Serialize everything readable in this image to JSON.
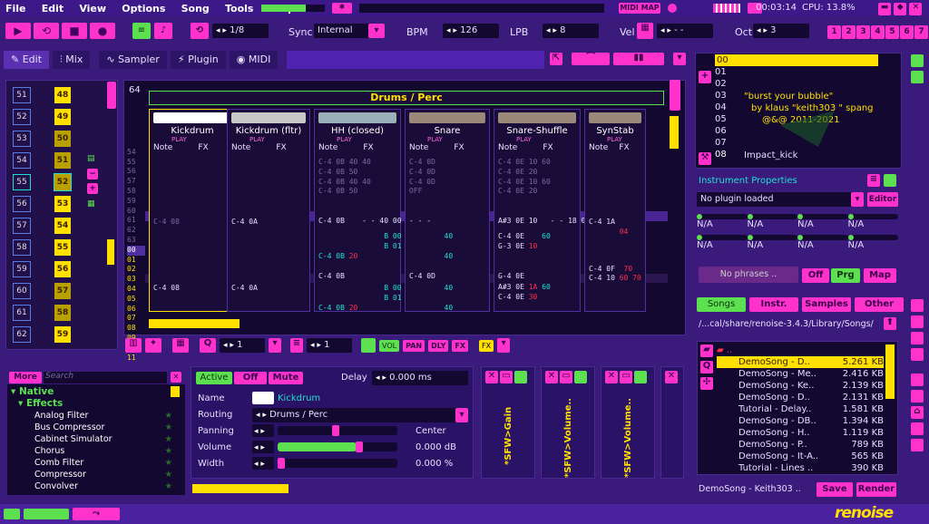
{
  "menu": [
    "File",
    "Edit",
    "View",
    "Options",
    "Song",
    "Tools",
    "Help"
  ],
  "top": {
    "midi_map": "MIDI MAP",
    "time": "00:03:14",
    "cpu": "CPU: 13.8%"
  },
  "transport": {
    "pattern_step": "1/8",
    "sync_label": "Sync",
    "sync_value": "Internal",
    "bpm_label": "BPM",
    "bpm": "126",
    "lpb_label": "LPB",
    "lpb": "8",
    "vel_label": "Vel",
    "vel": "- -",
    "oct_label": "Oct",
    "oct": "3",
    "octaves": [
      "1",
      "2",
      "3",
      "4",
      "5",
      "6",
      "7"
    ]
  },
  "tabs": {
    "edit": "Edit",
    "mix": "Mix",
    "sampler": "Sampler",
    "plugin": "Plugin",
    "midi": "MIDI"
  },
  "seq": {
    "left": [
      "51",
      "52",
      "53",
      "54",
      "55",
      "56",
      "57",
      "58",
      "59",
      "60",
      "61",
      "62"
    ],
    "right": [
      "48",
      "49",
      "50",
      "51",
      "52",
      "53",
      "54",
      "55",
      "56",
      "57",
      "58",
      "59"
    ],
    "pattern_lines": "64"
  },
  "pattern": {
    "group": "Drums / Perc",
    "tracks": [
      "Kickdrum",
      "Kickdrum (fltr)",
      "HH (closed)",
      "Snare",
      "Snare-Shuffle",
      "SynStab"
    ],
    "col_note": "Note",
    "col_fx": "FX",
    "play": "PLAY",
    "line_nums": [
      "54",
      "55",
      "56",
      "57",
      "58",
      "59",
      "60",
      "61",
      "62",
      "63",
      "00",
      "01",
      "02",
      "03",
      "04",
      "05",
      "06",
      "07",
      "08",
      "09",
      "10",
      "11",
      "12"
    ]
  },
  "instruments": {
    "list": [
      "00",
      "01",
      "02",
      "03",
      "04",
      "05",
      "06",
      "07",
      "08"
    ],
    "credits": [
      "\"burst your bubble\"",
      "by klaus \"keith303 \" spang",
      "@&@ 2011-2021"
    ],
    "selected": "Impact_kick",
    "props_title": "Instrument Properties",
    "plugin": "No plugin loaded",
    "editor": "Editor",
    "na": "N/A",
    "phrases": "No phrases ..",
    "off": "Off",
    "prg": "Prg",
    "map": "Map"
  },
  "browser": {
    "tabs": [
      "Songs",
      "Instr.",
      "Samples",
      "Other"
    ],
    "path": "/...cal/share/renoise-3.4.3/Library/Songs/",
    "up": "..",
    "files": [
      [
        "DemoSong - D..",
        "5.261 KB"
      ],
      [
        "DemoSong - Me..",
        "2.416 KB"
      ],
      [
        "DemoSong - Ke..",
        "2.139 KB"
      ],
      [
        "DemoSong - D..",
        "2.131 KB"
      ],
      [
        "Tutorial - Delay..",
        "1.581 KB"
      ],
      [
        "DemoSong - DB..",
        "1.394 KB"
      ],
      [
        "DemoSong - H..",
        "1.119 KB"
      ],
      [
        "DemoSong - P..",
        "789 KB"
      ],
      [
        "DemoSong - It-A..",
        "565 KB"
      ],
      [
        "Tutorial - Lines ..",
        "390 KB"
      ]
    ],
    "current": "DemoSong - Keith303 ..",
    "save": "Save",
    "render": "Render"
  },
  "pattern_toolbar": {
    "vol": "VOL",
    "pan": "PAN",
    "dly": "DLY",
    "fx": "FX",
    "edit_step": "1",
    "octave": "1"
  },
  "plugins": {
    "more": "More",
    "search": "Search",
    "root": "Native",
    "category": "Effects",
    "items": [
      "Analog Filter",
      "Bus Compressor",
      "Cabinet Simulator",
      "Chorus",
      "Comb Filter",
      "Compressor",
      "Convolver"
    ]
  },
  "track_dsp": {
    "active": "Active",
    "off": "Off",
    "mute": "Mute",
    "delay_label": "Delay",
    "delay": "0.000 ms",
    "name_label": "Name",
    "name": "Kickdrum",
    "routing_label": "Routing",
    "routing": "Drums / Perc",
    "panning_label": "Panning",
    "panning": "Center",
    "volume_label": "Volume",
    "volume": "0.000 dB",
    "width_label": "Width",
    "width": "0.000 %",
    "devices": [
      "*SFW>Gain",
      "*SFW>Volume..",
      "*SFW>Volume.."
    ]
  },
  "logo": "renoise",
  "colors": {
    "bg": "#3a1a7a",
    "accent": "#ff33cc",
    "yellow": "#ffe000",
    "green": "#5ce050",
    "cyan": "#20e0d0"
  }
}
